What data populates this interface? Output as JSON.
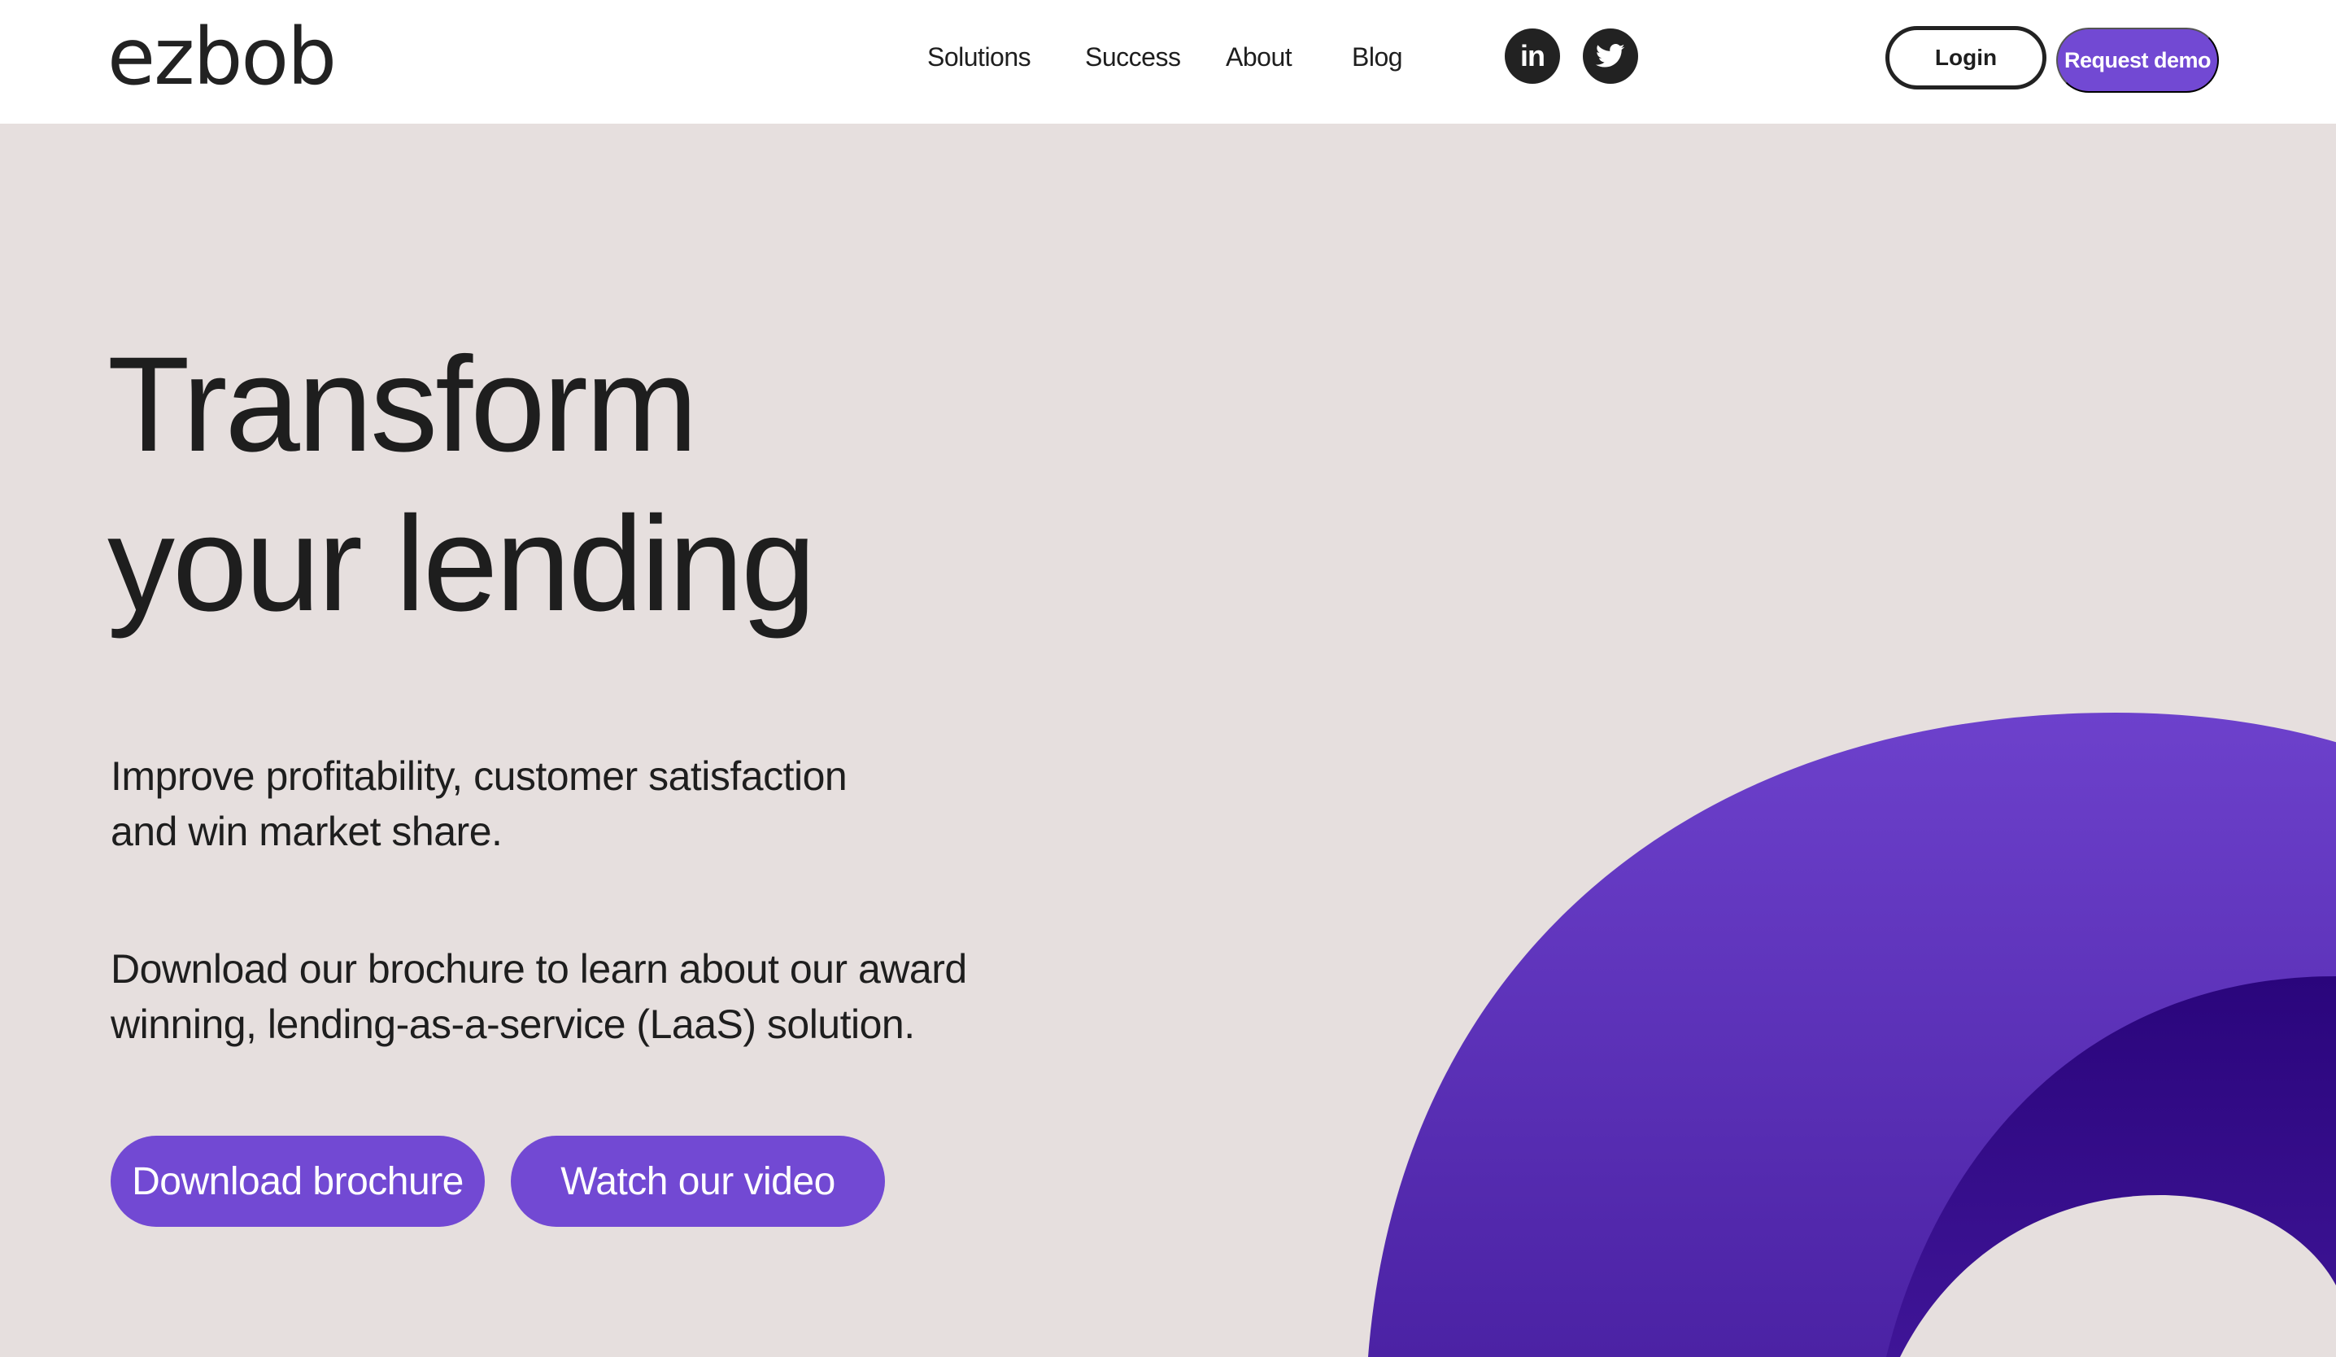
{
  "header": {
    "logo": "ezbob",
    "nav": [
      {
        "label": "Solutions"
      },
      {
        "label": "Success"
      },
      {
        "label": "About"
      },
      {
        "label": "Blog"
      }
    ],
    "social": [
      {
        "name": "linkedin-icon",
        "glyph": "in"
      },
      {
        "name": "twitter-icon",
        "glyph": ""
      }
    ],
    "login_label": "Login",
    "demo_label": "Request demo"
  },
  "hero": {
    "title_line1": "Transform",
    "title_line2": "your lending",
    "sub1_line1": "Improve profitability, customer satisfaction",
    "sub1_line2": "and win market share.",
    "sub2_line1": "Download our brochure to learn about our award",
    "sub2_line2": "winning, lending-as-a-service (LaaS) solution.",
    "download_label": "Download brochure",
    "video_label": "Watch our video"
  },
  "colors": {
    "accent": "#7249d3",
    "background": "#e6dfde",
    "dark_purple": "#2c0880",
    "text": "#1e1e1e"
  }
}
